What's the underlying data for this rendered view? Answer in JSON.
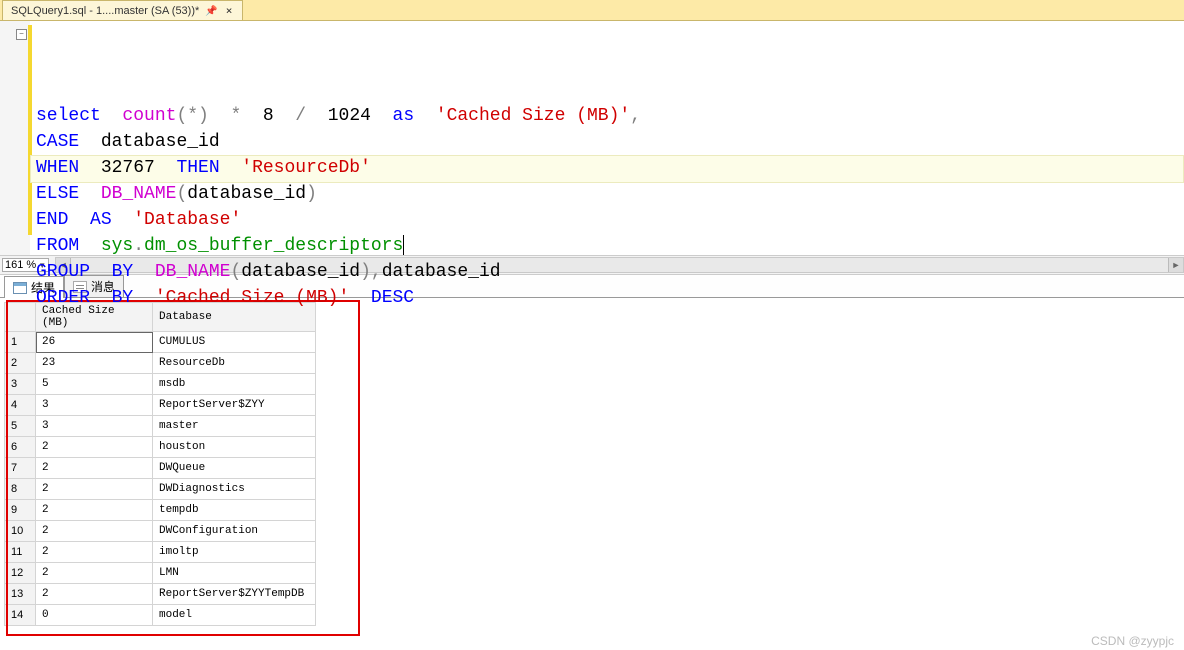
{
  "tab": {
    "title": "SQLQuery1.sql - 1....master (SA (53))*",
    "pinned": true
  },
  "editor": {
    "fold_glyph": "−",
    "highlight_line": 6,
    "tokens": [
      [
        [
          "kw",
          "select"
        ],
        [
          "",
          "  "
        ],
        [
          "agg",
          "count"
        ],
        [
          "sym",
          "(*)"
        ],
        [
          "",
          "  "
        ],
        [
          "sym",
          "*"
        ],
        [
          "",
          "  "
        ],
        [
          "num",
          "8"
        ],
        [
          "",
          "  "
        ],
        [
          "sym",
          "/"
        ],
        [
          "",
          "  "
        ],
        [
          "num",
          "1024"
        ],
        [
          "",
          "  "
        ],
        [
          "kw",
          "as"
        ],
        [
          "",
          "  "
        ],
        [
          "str",
          "'Cached Size (MB)'"
        ],
        [
          "sym",
          ","
        ]
      ],
      [
        [
          "kw",
          "CASE"
        ],
        [
          "",
          "  "
        ],
        [
          "",
          "database_id"
        ]
      ],
      [
        [
          "kw",
          "WHEN"
        ],
        [
          "",
          "  "
        ],
        [
          "num",
          "32767"
        ],
        [
          "",
          "  "
        ],
        [
          "kw",
          "THEN"
        ],
        [
          "",
          "  "
        ],
        [
          "str",
          "'ResourceDb'"
        ]
      ],
      [
        [
          "kw",
          "ELSE"
        ],
        [
          "",
          "  "
        ],
        [
          "func",
          "DB_NAME"
        ],
        [
          "sym",
          "("
        ],
        [
          "",
          "database_id"
        ],
        [
          "sym",
          ")"
        ]
      ],
      [
        [
          "kw",
          "END"
        ],
        [
          "",
          "  "
        ],
        [
          "kw",
          "AS"
        ],
        [
          "",
          "  "
        ],
        [
          "str",
          "'Database'"
        ]
      ],
      [
        [
          "kw",
          "FROM"
        ],
        [
          "",
          "  "
        ],
        [
          "obj",
          "sys"
        ],
        [
          "sym",
          "."
        ],
        [
          "obj",
          "dm_os_buffer_descriptors"
        ]
      ],
      [
        [
          "kw",
          "GROUP"
        ],
        [
          "",
          "  "
        ],
        [
          "kw",
          "BY"
        ],
        [
          "",
          "  "
        ],
        [
          "func",
          "DB_NAME"
        ],
        [
          "sym",
          "("
        ],
        [
          "",
          "database_id"
        ],
        [
          "sym",
          ")"
        ],
        [
          "sym",
          ","
        ],
        [
          "",
          "database_id"
        ]
      ],
      [
        [
          "kw",
          "ORDER"
        ],
        [
          "",
          "  "
        ],
        [
          "kw",
          "BY"
        ],
        [
          "",
          "  "
        ],
        [
          "str",
          "'Cached Size (MB)'"
        ],
        [
          "",
          "  "
        ],
        [
          "kw",
          "DESC"
        ]
      ]
    ]
  },
  "zoom": "161 %",
  "result_tabs": {
    "results": "结果",
    "messages": "消息",
    "active": 0
  },
  "grid": {
    "columns": [
      "Cached Size (MB)",
      "Database"
    ],
    "rows": [
      [
        "26",
        "CUMULUS"
      ],
      [
        "23",
        "ResourceDb"
      ],
      [
        "5",
        "msdb"
      ],
      [
        "3",
        "ReportServer$ZYY"
      ],
      [
        "3",
        "master"
      ],
      [
        "2",
        "houston"
      ],
      [
        "2",
        "DWQueue"
      ],
      [
        "2",
        "DWDiagnostics"
      ],
      [
        "2",
        "tempdb"
      ],
      [
        "2",
        "DWConfiguration"
      ],
      [
        "2",
        "imoltp"
      ],
      [
        "2",
        "LMN"
      ],
      [
        "2",
        "ReportServer$ZYYTempDB"
      ],
      [
        "0",
        "model"
      ]
    ],
    "selected_row": 1
  },
  "watermark": "CSDN @zyypjc"
}
